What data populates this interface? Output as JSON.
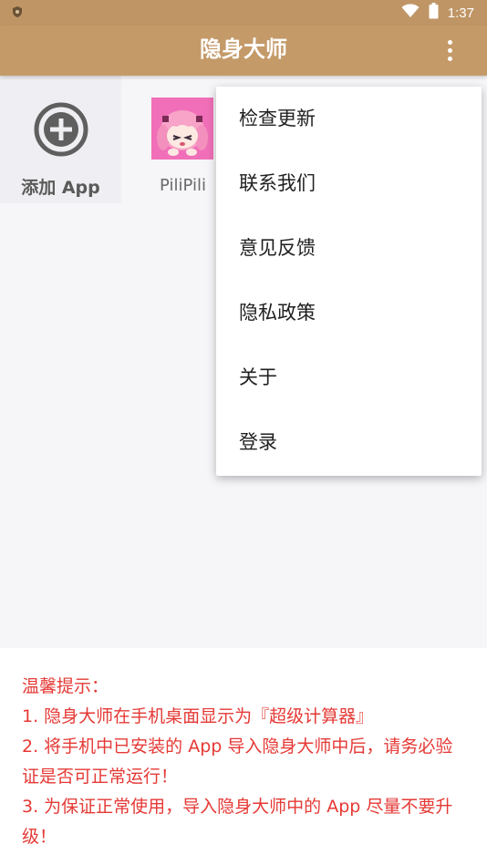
{
  "status_bar": {
    "time": "1:37",
    "left_icon": "shield-icon",
    "right_icons": [
      "wifi-icon",
      "battery-icon"
    ]
  },
  "app_bar": {
    "title": "隐身大师",
    "overflow_icon": "more-vert-icon"
  },
  "grid": {
    "add_tile": {
      "icon": "add-circle-icon",
      "label": "添加 App"
    },
    "apps": [
      {
        "name": "PiliPili",
        "icon": "pilipili-app-icon"
      }
    ]
  },
  "menu": {
    "items": [
      "检查更新",
      "联系我们",
      "意见反馈",
      "隐私政策",
      "关于",
      "登录"
    ]
  },
  "tips": {
    "heading": "温馨提示：",
    "line1": "1. 隐身大师在手机桌面显示为『超级计算器』",
    "line2": "2. 将手机中已安装的 App 导入隐身大师中后，请务必验证是否可正常运行！",
    "line3": "3. 为保证正常使用，导入隐身大师中的 App 尽量不要升级！"
  },
  "colors": {
    "app_bar": "#c49a69",
    "status_bar": "#bf9565",
    "tip_text": "#e53935"
  }
}
